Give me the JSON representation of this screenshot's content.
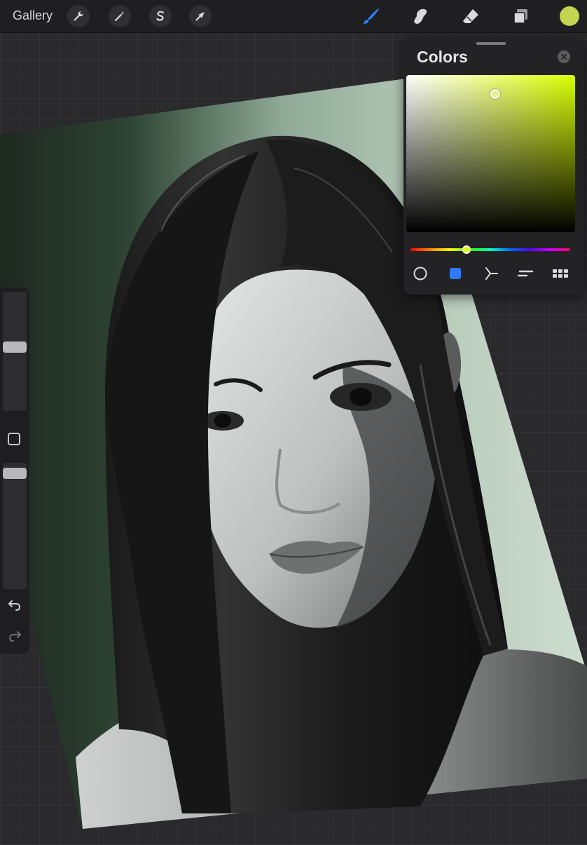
{
  "toolbar": {
    "gallery_label": "Gallery",
    "left_tools": [
      "wrench-icon",
      "magic-wand-icon",
      "selection-s-icon",
      "transform-arrow-icon"
    ],
    "right_tools": [
      "brush-icon",
      "smudge-icon",
      "eraser-icon",
      "layers-icon"
    ],
    "active_tool": "brush-icon",
    "current_color": "#c2d450",
    "active_color": "#2f7cf6"
  },
  "colors_panel": {
    "title": "Colors",
    "hue_color": "#d9ff00",
    "modes": [
      "disc-icon",
      "classic-icon",
      "harmony-icon",
      "value-icon",
      "palettes-icon"
    ],
    "active_mode": "classic-icon"
  },
  "sidebar": {
    "brush_size_level": 0.54,
    "opacity_level": 0.96
  },
  "canvas": {
    "background_green_dark": "#24342a",
    "background_green_light": "#c4d6c6"
  }
}
